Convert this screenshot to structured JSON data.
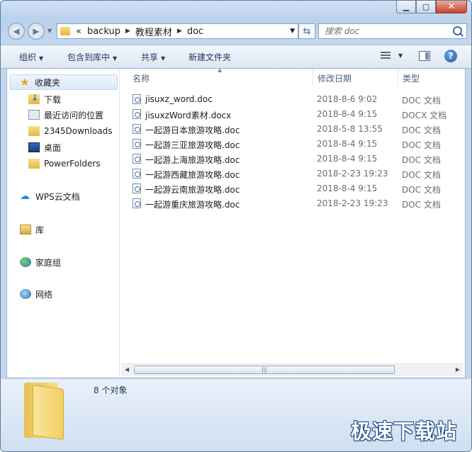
{
  "window": {
    "caption_buttons": [
      "minimize-icon",
      "maximize-icon",
      "close-icon"
    ]
  },
  "address": {
    "overflow": "«",
    "crumbs": [
      "backup",
      "教程素材",
      "doc"
    ]
  },
  "search": {
    "placeholder": "搜索 doc"
  },
  "toolbar": {
    "organize": "组织",
    "include_in_library": "包含到库中",
    "share": "共享",
    "new_folder": "新建文件夹"
  },
  "nav": {
    "favorites": "收藏夹",
    "downloads": "下载",
    "recent": "最近访问的位置",
    "downloads2345": "2345Downloads",
    "desktop": "桌面",
    "powerfolders": "PowerFolders",
    "wps_cloud": "WPS云文档",
    "libraries": "库",
    "homegroup": "家庭组",
    "network": "网络"
  },
  "columns": {
    "name": "名称",
    "date": "修改日期",
    "type": "类型"
  },
  "files": [
    {
      "name": "jisuxz_word.doc",
      "date": "2018-8-6 9:02",
      "type": "DOC 文档"
    },
    {
      "name": "jisuxzWord素材.docx",
      "date": "2018-8-4 9:15",
      "type": "DOCX 文档"
    },
    {
      "name": "一起游日本旅游攻略.doc",
      "date": "2018-5-8 13:55",
      "type": "DOC 文档"
    },
    {
      "name": "一起游三亚旅游攻略.doc",
      "date": "2018-8-4 9:15",
      "type": "DOC 文档"
    },
    {
      "name": "一起游上海旅游攻略.doc",
      "date": "2018-8-4 9:15",
      "type": "DOC 文档"
    },
    {
      "name": "一起游西藏旅游攻略.doc",
      "date": "2018-2-23 19:23",
      "type": "DOC 文档"
    },
    {
      "name": "一起游云南旅游攻略.doc",
      "date": "2018-8-4 9:15",
      "type": "DOC 文档"
    },
    {
      "name": "一起游重庆旅游攻略.doc",
      "date": "2018-2-23 19:23",
      "type": "DOC 文档"
    }
  ],
  "details": {
    "count": "8 个对象"
  },
  "watermark": "极速下载站",
  "colors": {
    "chrome": "#c2d8ef",
    "toolbar_text": "#1e395b",
    "secondary_text": "#6d6d6d"
  }
}
